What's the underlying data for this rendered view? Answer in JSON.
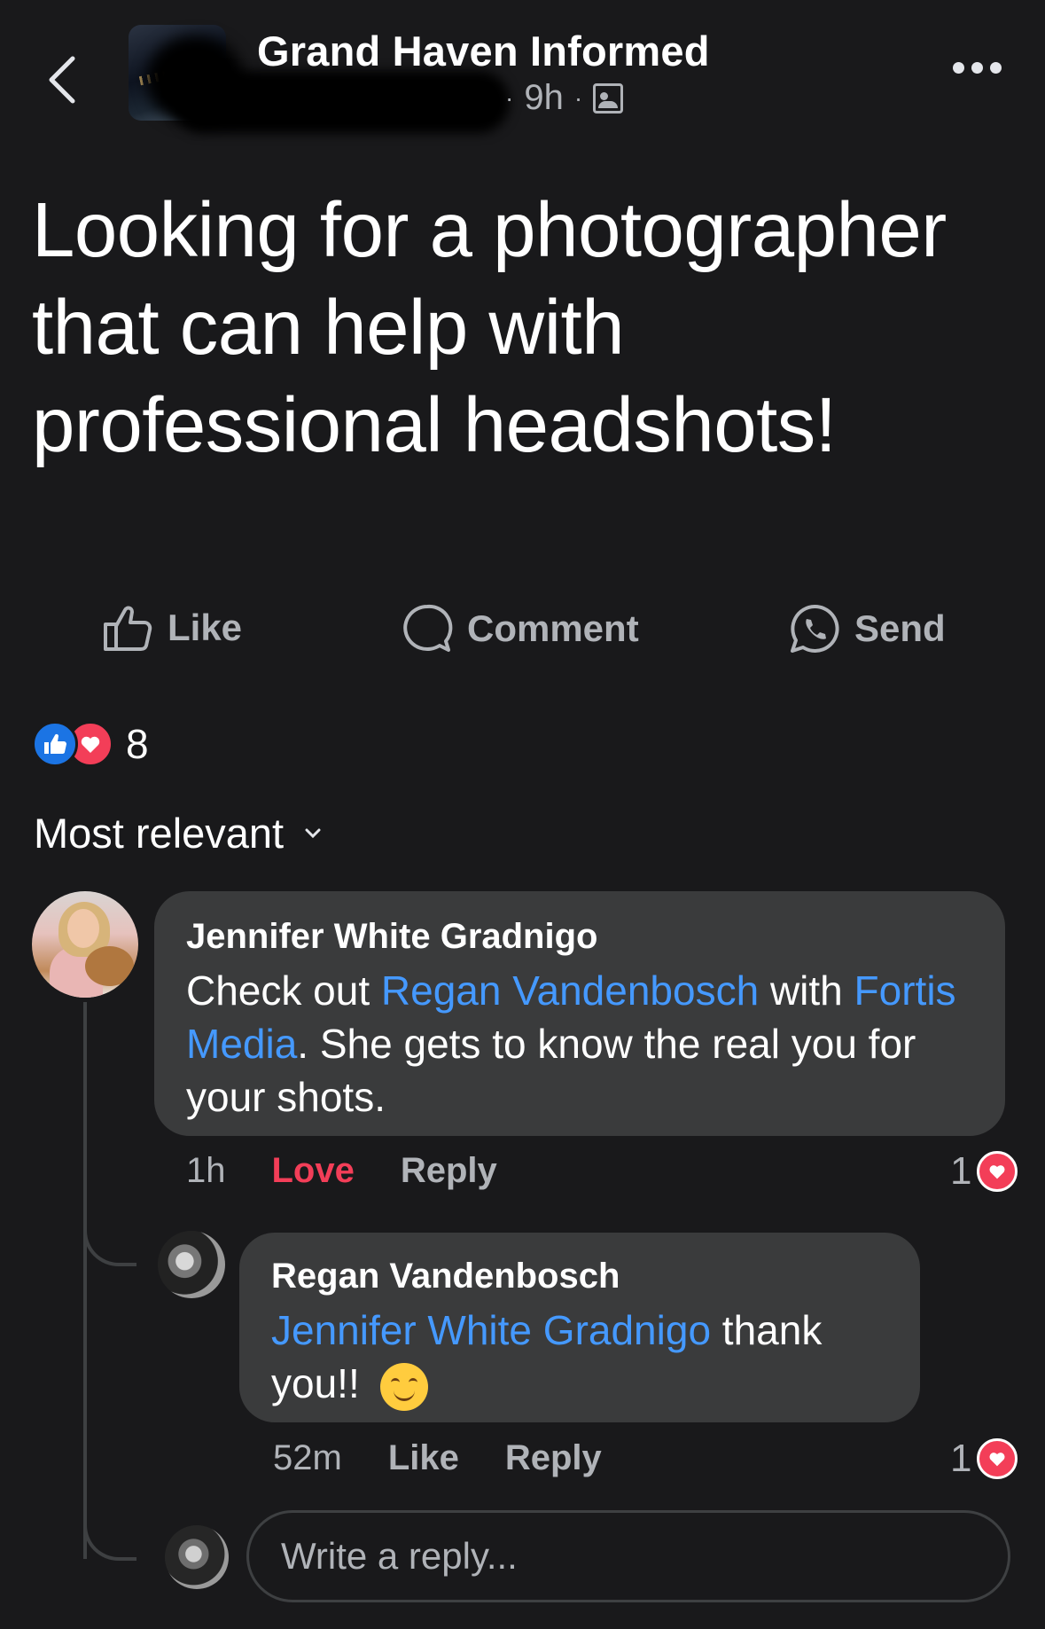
{
  "header": {
    "group_name": "Grand Haven Informed",
    "time": "9h",
    "separator": "·"
  },
  "post": {
    "text": "Looking for a photographer that can help with professional headshots!",
    "actions": {
      "like": "Like",
      "comment": "Comment",
      "send": "Send"
    },
    "reaction_count": "8"
  },
  "sort": {
    "label": "Most relevant"
  },
  "comments": [
    {
      "author": "Jennifer White Gradnigo",
      "text_parts": [
        "Check out ",
        "Regan Vandenbosch",
        " with ",
        "Fortis Media",
        ". She gets to know the real you for your shots."
      ],
      "time": "1h",
      "reaction_label": "Love",
      "reply_label": "Reply",
      "reaction_count": "1"
    },
    {
      "author": "Regan Vandenbosch",
      "text_parts": [
        "Jennifer White Gradnigo",
        " thank you!! "
      ],
      "time": "52m",
      "reaction_label": "Like",
      "reply_label": "Reply",
      "reaction_count": "1"
    }
  ],
  "reply_box": {
    "placeholder": "Write a reply..."
  },
  "colors": {
    "background": "#19191b",
    "bubble": "#3a3b3c",
    "mention": "#4599ff",
    "love": "#f33e58",
    "like": "#1b74e4"
  }
}
